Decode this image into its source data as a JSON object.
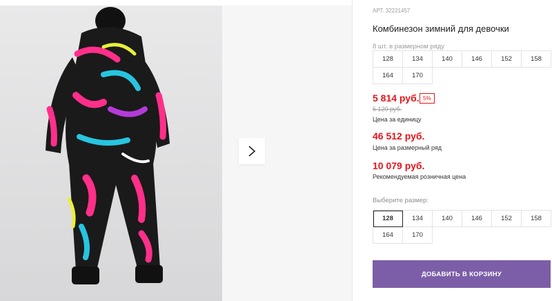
{
  "product": {
    "article": "АРТ. 32221457",
    "title": "Комбинезон зимний для девочки",
    "pack_note": "8 шт. в размерном ряду",
    "pack_sizes": [
      "128",
      "134",
      "140",
      "146",
      "152",
      "158",
      "164",
      "170"
    ]
  },
  "prices": {
    "unit_price": "5 814 руб.",
    "discount_badge": "5%",
    "old_price": "6 120 руб.",
    "unit_caption": "Цена за единицу",
    "range_price": "46 512 руб.",
    "range_caption": "Цена за размерный ряд",
    "retail_price": "10 079 руб.",
    "retail_caption": "Рекомендуемая розничная цена"
  },
  "size_select": {
    "label": "Выберите размер:",
    "options": [
      "128",
      "134",
      "140",
      "146",
      "152",
      "158",
      "164",
      "170"
    ],
    "selected": "128"
  },
  "cart_button": "ДОБАВИТЬ В КОРЗИНУ",
  "colors": {
    "price_red": "#e3141b",
    "button_purple": "#7b5ea7"
  },
  "icons": {
    "next": "chevron-right-icon"
  }
}
